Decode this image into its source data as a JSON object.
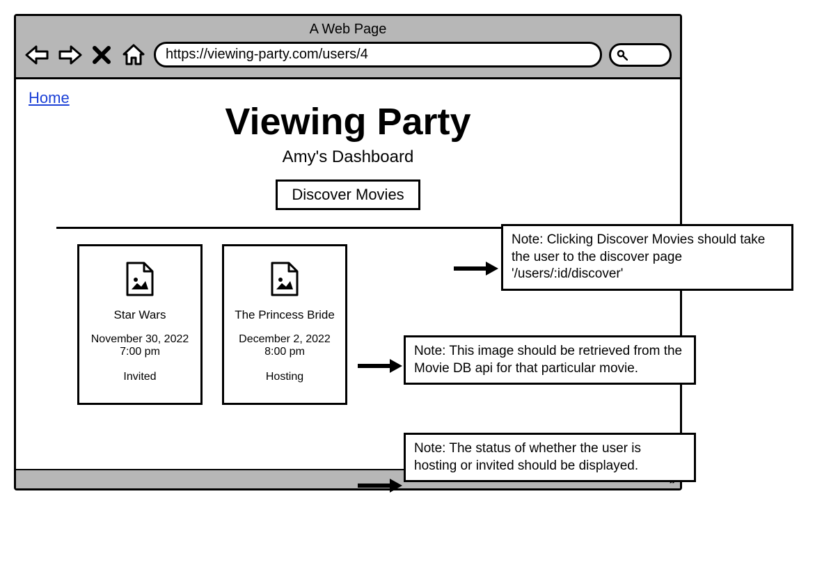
{
  "chrome": {
    "title": "A Web Page",
    "url": "https://viewing-party.com/users/4"
  },
  "nav": {
    "home_link": "Home"
  },
  "header": {
    "title": "Viewing Party",
    "subtitle": "Amy's Dashboard",
    "discover_button": "Discover Movies"
  },
  "cards": [
    {
      "title": "Star Wars",
      "date": "November 30, 2022",
      "time": "7:00 pm",
      "status": "Invited"
    },
    {
      "title": "The Princess Bride",
      "date": "December 2, 2022",
      "time": "8:00 pm",
      "status": "Hosting"
    }
  ],
  "notes": {
    "discover": "Note: Clicking Discover Movies should take the user to the discover page '/users/:id/discover'",
    "image": "Note: This image should be retrieved from the Movie DB api for that particular movie.",
    "status": "Note: The status of whether the user is hosting or invited should be displayed."
  }
}
